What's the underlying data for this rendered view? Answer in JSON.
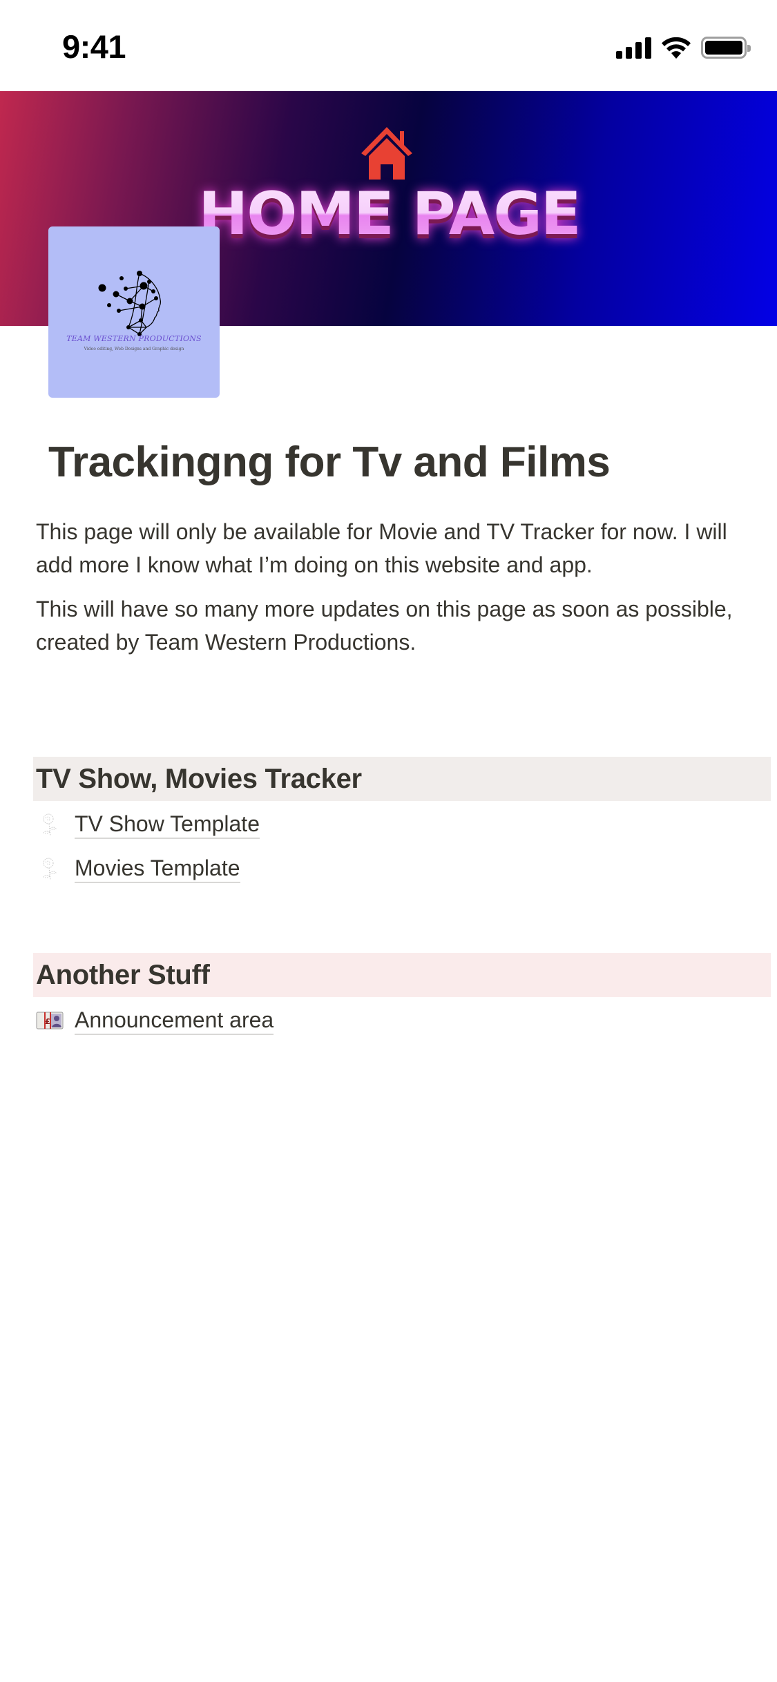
{
  "status_bar": {
    "time": "9:41",
    "icons": [
      "cellular-signal-icon",
      "wifi-icon",
      "battery-icon"
    ]
  },
  "cover": {
    "icon": "house-icon",
    "title": "HOME PAGE",
    "colors": {
      "house": "#e84133",
      "text": "#f2c8f7",
      "glow": "#d53bc4"
    }
  },
  "page_icon": {
    "background": "#b3bdf7",
    "logo_name": "TEAM WESTERN PRODUCTIONS",
    "logo_tagline": "Video editing, Web Designs and Graphic design"
  },
  "page": {
    "title": "Trackingng for Tv and Films",
    "paragraphs": [
      "This page will only be available for Movie and TV Tracker for now. I will add more I know what I’m doing on this website and app.",
      "This will have so many more updates on this page as soon as possible, created by Team Western Productions."
    ]
  },
  "sections": [
    {
      "heading": "TV Show, Movies Tracker",
      "background": "#f1edeb",
      "links": [
        {
          "label": "TV Show Template",
          "icon": "rose-sketch-icon"
        },
        {
          "label": "Movies Template",
          "icon": "rose-sketch-icon"
        }
      ]
    },
    {
      "heading": "Another Stuff",
      "background": "#faebeb",
      "links": [
        {
          "label": "Announcement area",
          "icon": "pound-banknote-icon"
        }
      ]
    }
  ]
}
